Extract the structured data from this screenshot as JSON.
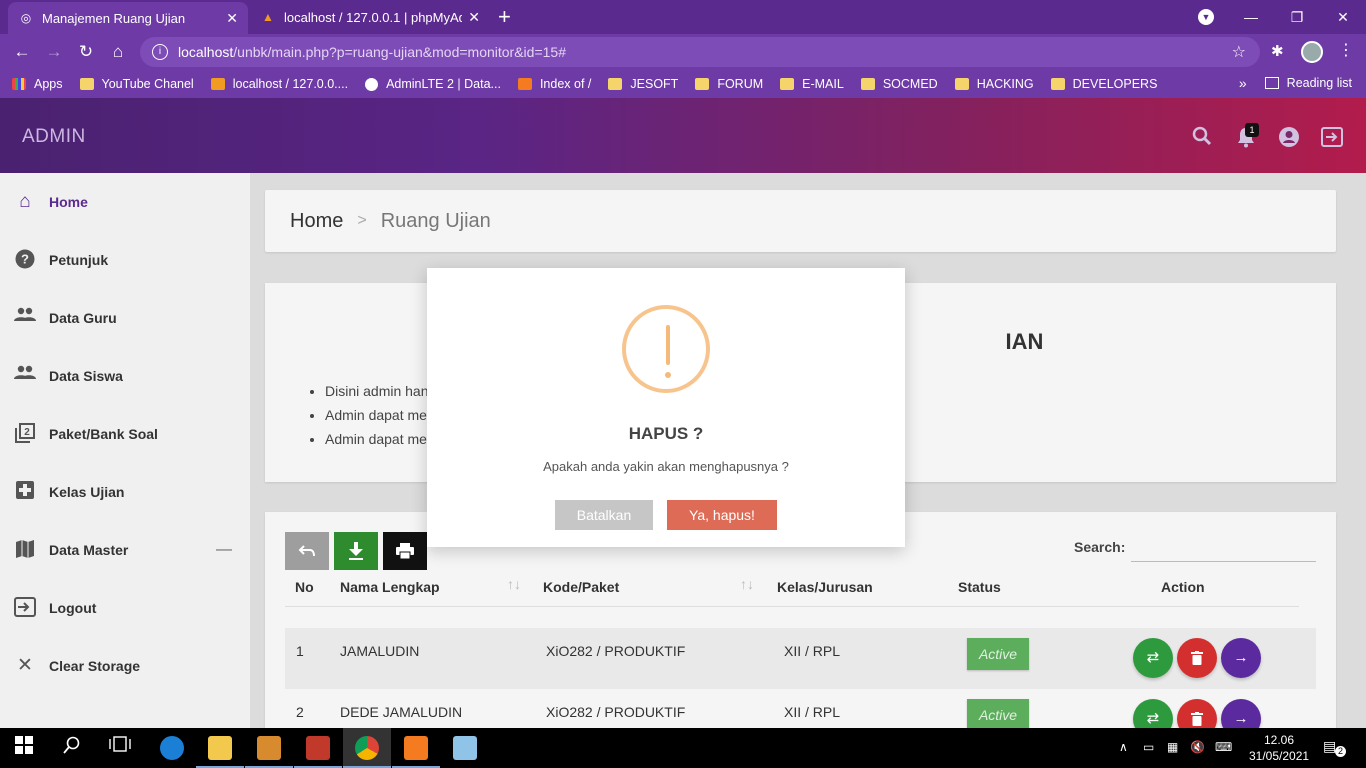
{
  "browser": {
    "tabs": [
      {
        "title": "Manajemen Ruang Ujian",
        "active": true
      },
      {
        "title": "localhost / 127.0.0.1 | phpMyAdmin",
        "active": false
      }
    ],
    "url_host": "localhost",
    "url_path": "/unbk/main.php?p=ruang-ujian&mod=monitor&id=15#",
    "bookmarks": [
      "Apps",
      "YouTube Chanel",
      "localhost / 127.0.0....",
      "AdminLTE 2 | Data...",
      "Index of /",
      "JESOFT",
      "FORUM",
      "E-MAIL",
      "SOCMED",
      "HACKING",
      "DEVELOPERS"
    ],
    "reading_list": "Reading list",
    "more": "»"
  },
  "header": {
    "brand": "ADMIN",
    "notif_count": "1"
  },
  "sidebar": {
    "items": [
      {
        "label": "Home",
        "icon": "home-icon"
      },
      {
        "label": "Petunjuk",
        "icon": "help-icon"
      },
      {
        "label": "Data Guru",
        "icon": "people-icon"
      },
      {
        "label": "Data Siswa",
        "icon": "people-icon"
      },
      {
        "label": "Paket/Bank Soal",
        "icon": "filter-2-icon"
      },
      {
        "label": "Kelas Ujian",
        "icon": "hospital-icon"
      },
      {
        "label": "Data Master",
        "icon": "map-icon"
      },
      {
        "label": "Logout",
        "icon": "exit-icon"
      },
      {
        "label": "Clear Storage",
        "icon": "close-icon"
      }
    ],
    "collapse_symbol": "—"
  },
  "breadcrumb": {
    "home": "Home",
    "sep": ">",
    "current": "Ruang Ujian"
  },
  "info": {
    "title_visible": "IAN",
    "items": [
      "Disini admin han",
      "Admin dapat me",
      "Admin dapat me"
    ]
  },
  "table": {
    "search_label": "Search:",
    "search_value": "",
    "columns": [
      "No",
      "Nama Lengkap",
      "Kode/Paket",
      "Kelas/Jurusan",
      "Status",
      "Action"
    ],
    "rows": [
      {
        "no": "1",
        "nama": "JAMALUDIN",
        "kode": "XiO282 / PRODUKTIF",
        "kelas": "XII / RPL",
        "status": "Active"
      },
      {
        "no": "2",
        "nama": "DEDE JAMALUDIN",
        "kode": "XiO282 / PRODUKTIF",
        "kelas": "XII / RPL",
        "status": "Active"
      }
    ]
  },
  "modal": {
    "title": "HAPUS ?",
    "text": "Apakah anda yakin akan menghapusnya ?",
    "cancel": "Batalkan",
    "confirm": "Ya, hapus!"
  },
  "taskbar": {
    "time": "12.06",
    "date": "31/05/2021",
    "notifications": "2"
  },
  "colors": {
    "accent": "#5b2a8f",
    "warning": "#f8c48e",
    "danger": "#dd6b55",
    "success": "#5cad5c"
  }
}
